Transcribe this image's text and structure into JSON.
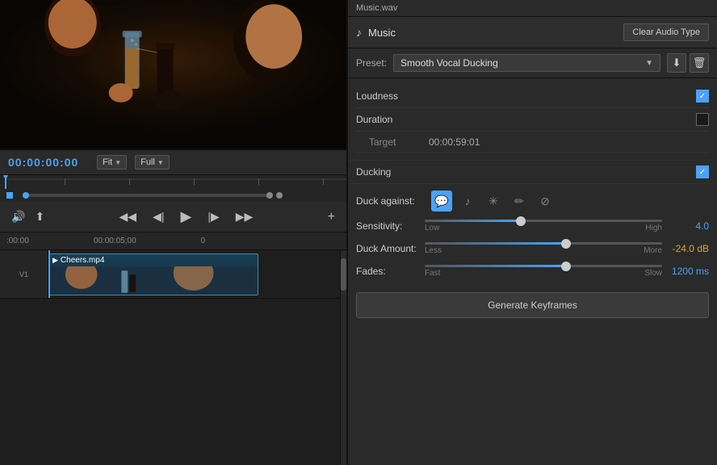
{
  "leftPanel": {
    "timecode": "00:00:00:00",
    "fitLabel": "Fit",
    "fullLabel": "Full",
    "timelineMarkers": [
      ":00:00",
      "00:00:05;00",
      "0"
    ],
    "clipName": "Cheers.mp4"
  },
  "rightPanel": {
    "fileTitle": "Music.wav",
    "musicLabel": "Music",
    "clearAudioBtn": "Clear Audio Type",
    "presetLabel": "Preset:",
    "presetValue": "Smooth Vocal Ducking",
    "loudnessLabel": "Loudness",
    "durationLabel": "Duration",
    "targetLabel": "Target",
    "targetValue": "00:00:59:01",
    "duckingLabel": "Ducking",
    "duckAgainstLabel": "Duck against:",
    "sensitivityLabel": "Sensitivity:",
    "sensitivityMin": "Low",
    "sensitivityMax": "High",
    "sensitivityValue": "4.0",
    "duckAmountLabel": "Duck Amount:",
    "duckAmountMin": "Less",
    "duckAmountMax": "More",
    "duckAmountValue": "-24.0",
    "duckAmountUnit": "dB",
    "fadesLabel": "Fades:",
    "fadesMin": "Fast",
    "fadesMax": "Slow",
    "fadesValue": "1200",
    "fadesUnit": "ms",
    "generateBtn": "Generate Keyframes",
    "icons": {
      "download": "⬇",
      "trash": "🗑",
      "speechBubble": "💬",
      "musicNote": "♪",
      "sparkle": "✳",
      "brush": "✏",
      "slash": "⊘"
    }
  }
}
